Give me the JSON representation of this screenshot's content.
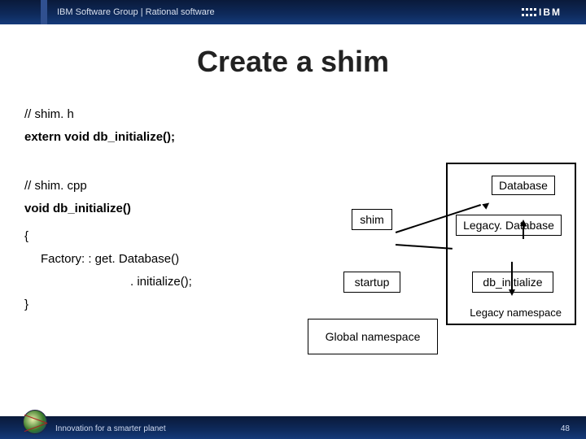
{
  "header": {
    "group_text": "IBM Software Group | Rational software",
    "logo_text": "IBM"
  },
  "title": "Create a shim",
  "code": {
    "l1": "// shim. h",
    "l2": "extern void db_initialize();",
    "l3": "// shim. cpp",
    "l4": "void db_initialize()",
    "l5": "{",
    "l6": "Factory: : get. Database()",
    "l7": ". initialize();",
    "l8": "}"
  },
  "diagram": {
    "database": "Database",
    "shim": "shim",
    "legacy_db": "Legacy. Database",
    "startup": "startup",
    "db_init": "db_initialize",
    "global_ns": "Global namespace",
    "legacy_ns": "Legacy namespace"
  },
  "footer": {
    "tagline": "Innovation for a smarter planet",
    "page_num": "48"
  }
}
